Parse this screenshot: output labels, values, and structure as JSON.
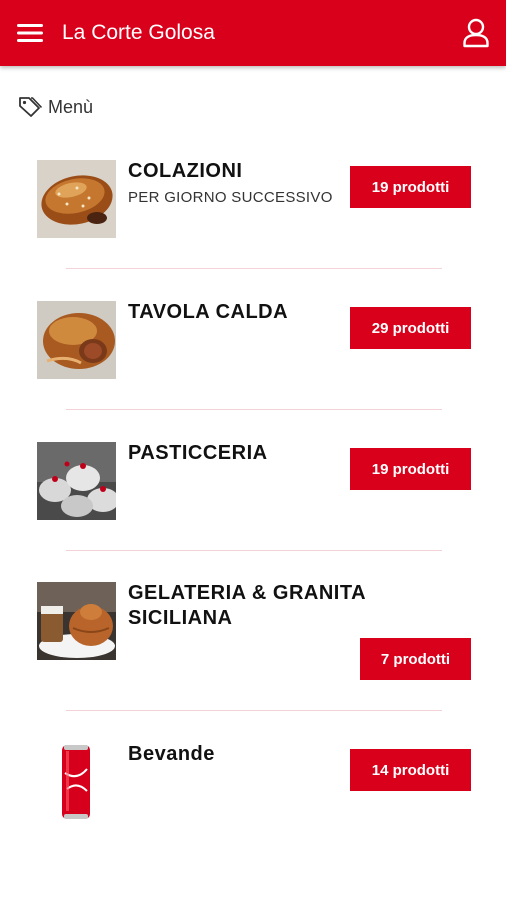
{
  "app": {
    "title": "La Corte Golosa",
    "accent_color": "#d9001b",
    "menu_icon": "hamburger-icon",
    "user_icon": "user-icon"
  },
  "section": {
    "icon": "tag-icon",
    "label": "Menù"
  },
  "categories": [
    {
      "title": "COLAZIONI",
      "subtitle": "PER GIORNO SUCCESSIVO",
      "badge": "19 prodotti",
      "image": "croissant"
    },
    {
      "title": "TAVOLA CALDA",
      "subtitle": "",
      "badge": "29 prodotti",
      "image": "pastry-roll"
    },
    {
      "title": "PASTICCERIA",
      "subtitle": "",
      "badge": "19 prodotti",
      "image": "minne-pastries"
    },
    {
      "title": "GELATERIA & GRANITA SICILIANA",
      "subtitle": "",
      "badge": "7 prodotti",
      "image": "granita-brioche"
    },
    {
      "title": "Bevande",
      "subtitle": "",
      "badge": "14 prodotti",
      "image": "cola-can"
    }
  ]
}
